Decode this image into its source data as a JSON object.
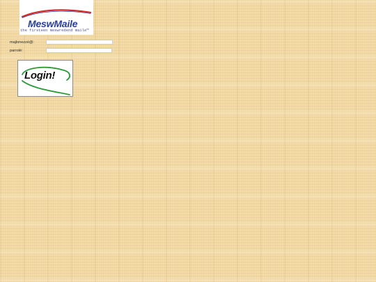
{
  "brand": {
    "name": "MeswMaile",
    "tagline": "the firsteen meswredend maile™",
    "logo_text_color": "#2a3f9a",
    "logo_swoosh_color": "#d42a2a"
  },
  "login_form": {
    "username_label": "majlonezzé@:",
    "password_label": "parrolé:",
    "username_value": "",
    "password_value": ""
  },
  "login_button": {
    "label": "Login!",
    "swoosh_color": "#2d9a3a"
  }
}
